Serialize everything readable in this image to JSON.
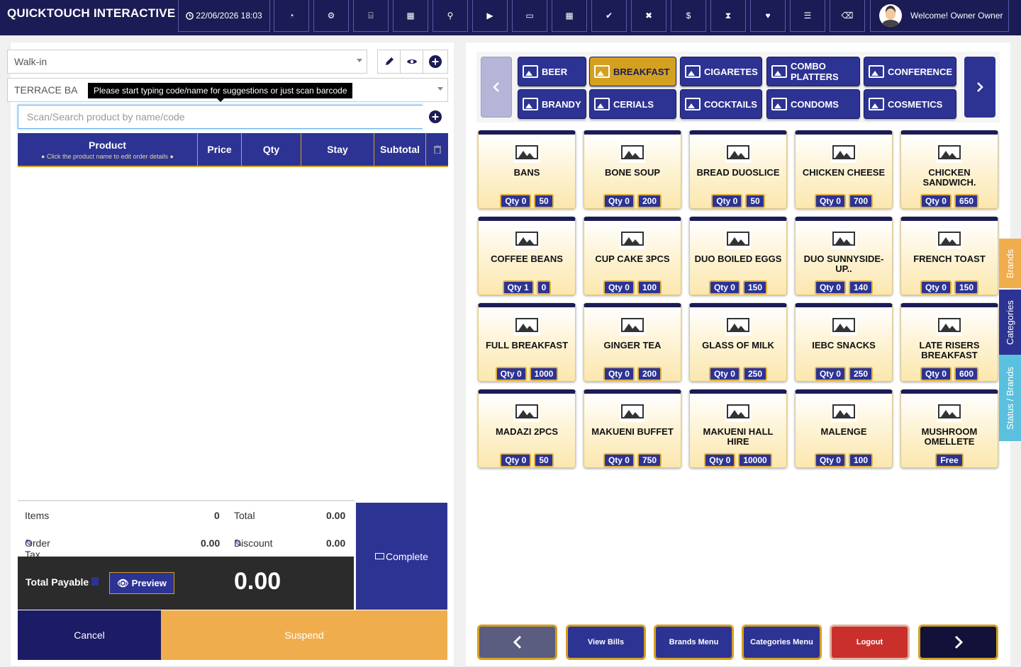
{
  "header": {
    "brand": "QUICKTOUCH INTERACTIVE",
    "datetime": "22/06/2026 18:03",
    "welcome": "Welcome! Owner Owner",
    "toolbar_icons": [
      "dashboard-icon",
      "settings-icon",
      "html5-icon",
      "calculator-icon",
      "key-icon",
      "play-icon",
      "laptop-icon",
      "grid-icon",
      "check-circle-icon",
      "close-circle-icon",
      "dollar-icon",
      "hourglass-icon",
      "heart-icon",
      "list-icon",
      "eraser-icon"
    ]
  },
  "order": {
    "customer": "Walk-in",
    "table": "TERRACE BA",
    "tooltip": "Please start typing code/name for suggestions or just scan barcode",
    "search_placeholder": "Scan/Search product by name/code",
    "columns": {
      "product": "Product",
      "product_hint": "Click the product name to edit order details",
      "price": "Price",
      "qty": "Qty",
      "stay": "Stay",
      "subtotal": "Subtotal"
    }
  },
  "summary": {
    "items_label": "Items",
    "items_value": "0",
    "total_label": "Total",
    "total_value": "0.00",
    "order_tax_label": "Order Tax",
    "order_tax_value": "0.00",
    "discount_label": "Discount",
    "discount_value": "0.00",
    "total_payable_label": "Total Payable",
    "preview_label": "Preview",
    "total_payable_value": "0.00",
    "complete_label": "Complete",
    "cancel_label": "Cancel",
    "suspend_label": "Suspend"
  },
  "categories": [
    {
      "label": "BEER",
      "active": false
    },
    {
      "label": "BREAKFAST",
      "active": true
    },
    {
      "label": "CIGARETES",
      "active": false
    },
    {
      "label": "COMBO PLATTERS",
      "active": false
    },
    {
      "label": "CONFERENCE",
      "active": false
    },
    {
      "label": "BRANDY",
      "active": false
    },
    {
      "label": "CERIALS",
      "active": false
    },
    {
      "label": "COCKTAILS",
      "active": false
    },
    {
      "label": "CONDOMS",
      "active": false
    },
    {
      "label": "COSMETICS",
      "active": false
    }
  ],
  "products": [
    {
      "name": "BANS",
      "qty": "Qty 0",
      "price": "50"
    },
    {
      "name": "BONE SOUP",
      "qty": "Qty 0",
      "price": "200"
    },
    {
      "name": "BREAD DUOSLICE",
      "qty": "Qty 0",
      "price": "50"
    },
    {
      "name": "CHICKEN CHEESE",
      "qty": "Qty 0",
      "price": "700"
    },
    {
      "name": "CHICKEN SANDWICH.",
      "qty": "Qty 0",
      "price": "650"
    },
    {
      "name": "COFFEE BEANS",
      "qty": "Qty 1",
      "price": "0"
    },
    {
      "name": "CUP CAKE 3PCS",
      "qty": "Qty 0",
      "price": "100"
    },
    {
      "name": "DUO BOILED EGGS",
      "qty": "Qty 0",
      "price": "150"
    },
    {
      "name": "DUO SUNNYSIDE-UP..",
      "qty": "Qty 0",
      "price": "140"
    },
    {
      "name": "FRENCH TOAST",
      "qty": "Qty 0",
      "price": "150"
    },
    {
      "name": "FULL BREAKFAST",
      "qty": "Qty 0",
      "price": "1000"
    },
    {
      "name": "GINGER TEA",
      "qty": "Qty 0",
      "price": "200"
    },
    {
      "name": "GLASS OF MILK",
      "qty": "Qty 0",
      "price": "250"
    },
    {
      "name": "IEBC SNACKS",
      "qty": "Qty 0",
      "price": "250"
    },
    {
      "name": "LATE RISERS BREAKFAST",
      "qty": "Qty 0",
      "price": "600"
    },
    {
      "name": "MADAZI 2PCS",
      "qty": "Qty 0",
      "price": "50"
    },
    {
      "name": "MAKUENI BUFFET",
      "qty": "Qty 0",
      "price": "750"
    },
    {
      "name": "MAKUENI HALL HIRE",
      "qty": "Qty 0",
      "price": "10000"
    },
    {
      "name": "MALENGE",
      "qty": "Qty 0",
      "price": "100"
    },
    {
      "name": "MUSHROOM OMELLETE",
      "qty": "",
      "price": "Free"
    }
  ],
  "side_tabs": [
    {
      "label": "Brands",
      "color": "#f0ad4e"
    },
    {
      "label": "Categories",
      "color": "#2d3393"
    },
    {
      "label": "Status / Brands",
      "color": "#5bc0de"
    }
  ],
  "bottom_buttons": {
    "view_bills": "View Bills",
    "brands_menu": "Brands Menu",
    "categories_menu": "Categories Menu",
    "logout": "Logout"
  },
  "colors": {
    "primary": "#2d3393",
    "dark": "#1b1b55",
    "accent": "#d4a020",
    "suspend": "#f0ad4e",
    "logout": "#c9302c"
  }
}
